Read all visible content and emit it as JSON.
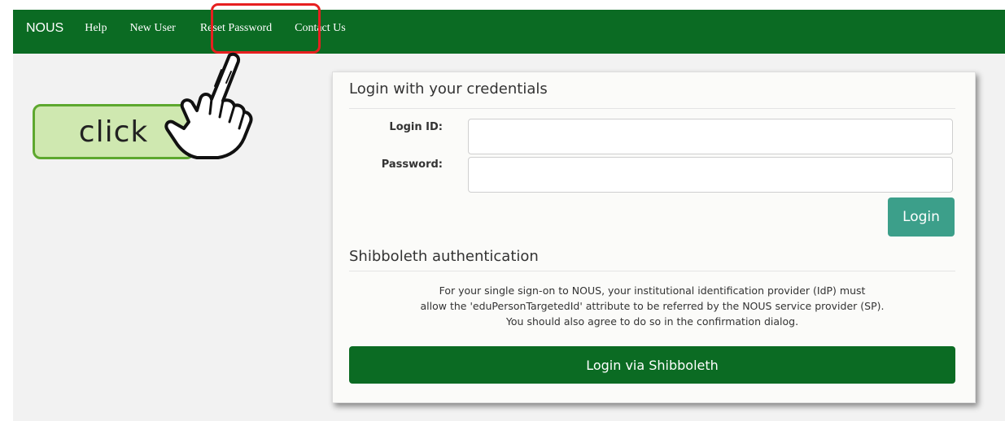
{
  "navbar": {
    "brand": "NOUS",
    "links": [
      "Help",
      "New User",
      "Reset Password",
      "Contact Us"
    ],
    "color": "#0b6b23"
  },
  "annotation": {
    "click_label": "click",
    "highlight_color": "#e62020",
    "badge_color": "#cfe8b0",
    "badge_border": "#5da82e",
    "icon": "pointing-hand-icon"
  },
  "login": {
    "title": "Login with your credentials",
    "id_label": "Login ID:",
    "id_value": "",
    "password_label": "Password:",
    "password_value": "",
    "button": "Login",
    "button_color": "#3c9f8a"
  },
  "shibboleth": {
    "title": "Shibboleth authentication",
    "notice_lines": [
      "For your single sign-on to NOUS, your institutional identification provider (IdP) must",
      "allow the 'eduPersonTargetedId' attribute to be referred by the NOUS service provider (SP).",
      "You should also agree to do so in the confirmation dialog."
    ],
    "button": "Login via Shibboleth",
    "button_color": "#0b6b23"
  }
}
